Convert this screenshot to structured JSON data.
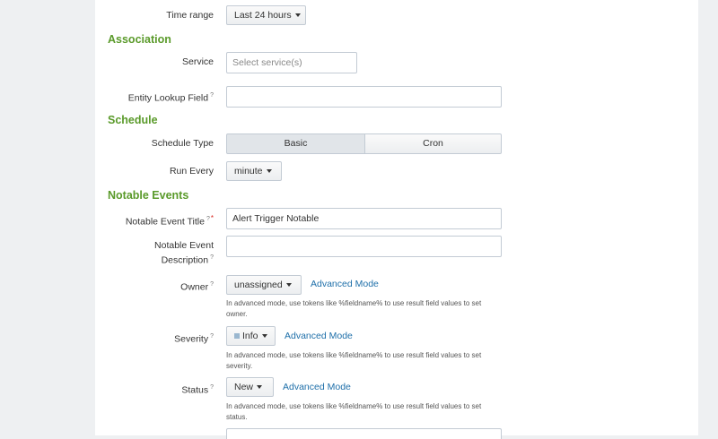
{
  "time_range": {
    "label": "Time range",
    "value": "Last 24 hours"
  },
  "association": {
    "heading": "Association",
    "service": {
      "label": "Service",
      "placeholder": "Select service(s)"
    },
    "entity_lookup": {
      "label": "Entity Lookup Field",
      "help_mark": "?",
      "value": ""
    }
  },
  "schedule": {
    "heading": "Schedule",
    "type": {
      "label": "Schedule Type",
      "options": [
        "Basic",
        "Cron"
      ],
      "selected": "Basic"
    },
    "run_every": {
      "label": "Run Every",
      "value": "minute"
    }
  },
  "notable": {
    "heading": "Notable Events",
    "title": {
      "label": "Notable Event Title",
      "help_mark": "?",
      "required_mark": "*",
      "value": "Alert Trigger Notable"
    },
    "description": {
      "label_line1": "Notable Event",
      "label_line2": "Description",
      "help_mark": "?",
      "value": ""
    },
    "owner": {
      "label": "Owner",
      "help_mark": "?",
      "value": "unassigned",
      "advanced": "Advanced Mode",
      "help_line1": "In advanced mode, use tokens like %fieldname% to use result field values to set",
      "help_line2": "owner."
    },
    "severity": {
      "label": "Severity",
      "help_mark": "?",
      "value": "Info",
      "advanced": "Advanced Mode",
      "help_line1": "In advanced mode, use tokens like %fieldname% to use result field values to set",
      "help_line2": "severity."
    },
    "status": {
      "label": "Status",
      "help_mark": "?",
      "value": "New",
      "advanced": "Advanced Mode",
      "help_line1": "In advanced mode, use tokens like %fieldname% to use result field values to set",
      "help_line2": "status."
    }
  },
  "colors": {
    "section_heading": "#5a9a2a",
    "link": "#1e6fa9",
    "required": "#d9251d",
    "severity_info": "#9ab7cf"
  }
}
